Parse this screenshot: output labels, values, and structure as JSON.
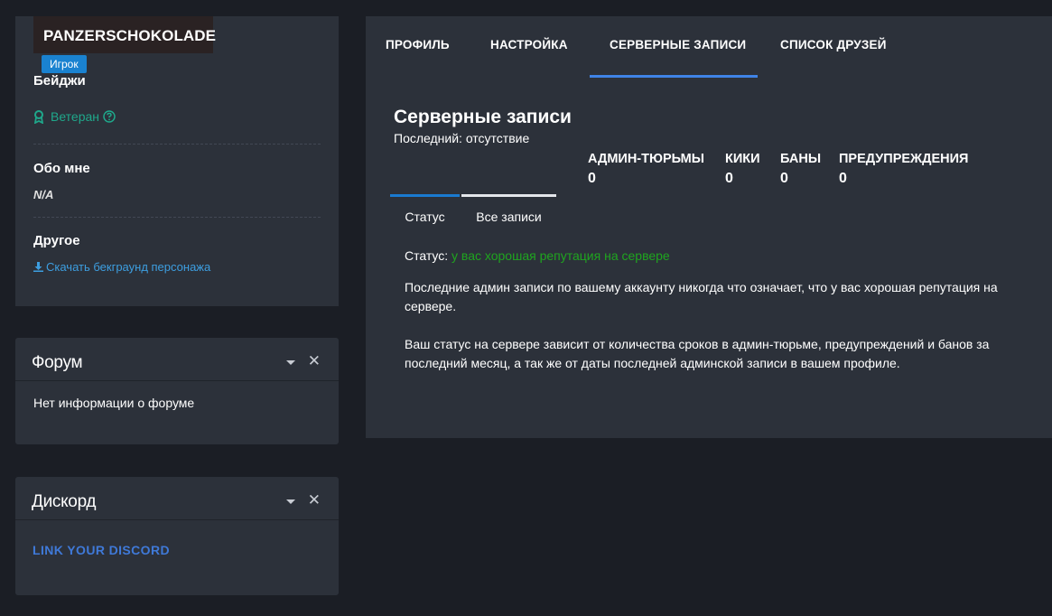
{
  "profile": {
    "username": "PANZERSCHOKOLADE",
    "role": "Игрок",
    "badges_title": "Бейджи",
    "badge_name": "Ветеран",
    "about_title": "Обо мне",
    "about_value": "N/A",
    "other_title": "Другое",
    "download_link": "Скачать бекграунд персонажа"
  },
  "forum": {
    "title": "Форум",
    "text": "Нет информации о форуме"
  },
  "discord": {
    "title": "Дискорд",
    "link": "LINK YOUR DISCORD"
  },
  "nav": {
    "tabs": [
      "ПРОФИЛЬ",
      "НАСТРОЙКА",
      "СЕРВЕРНЫЕ ЗАПИСИ",
      "СПИСОК ДРУЗЕЙ"
    ],
    "active": "СЕРВЕРНЫЕ ЗАПИСИ"
  },
  "records": {
    "title": "Серверные записи",
    "last": "Последний: отсутствие",
    "stats": [
      {
        "label": "АДМИН-ТЮРЬМЫ",
        "value": "0"
      },
      {
        "label": "КИКИ",
        "value": "0"
      },
      {
        "label": "БАНЫ",
        "value": "0"
      },
      {
        "label": "ПРЕДУПРЕЖДЕНИЯ",
        "value": "0"
      }
    ],
    "subtabs": [
      "Статус",
      "Все записи"
    ],
    "status_label": "Статус:",
    "status_value": "у вас хорошая репутация на сервере",
    "paragraph1": "Последние админ записи по вашему аккаунту никогда что означает, что у вас хорошая репутация на сервере.",
    "paragraph2": "Ваш статус на сервере зависит от количества сроков в админ-тюрьме, предупреждений и банов за последний месяц, а так же от даты последней админской записи в вашем профиле."
  },
  "colors": {
    "accent": "#3f83e6",
    "badge_green": "#1fa88b",
    "status_green": "#1fa51f",
    "link_blue": "#3d9ee0",
    "role_badge": "#1a82d0"
  }
}
